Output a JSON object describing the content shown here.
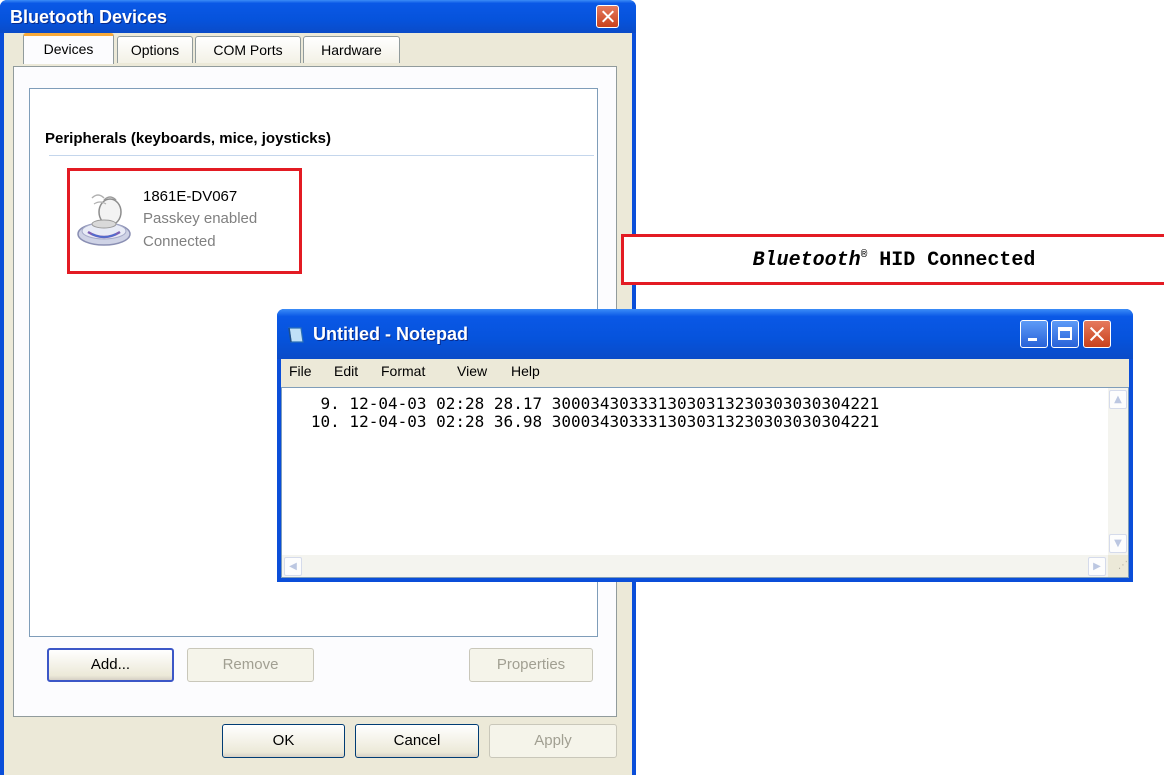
{
  "bt_window": {
    "title": "Bluetooth Devices",
    "tabs": [
      "Devices",
      "Options",
      "COM Ports",
      "Hardware"
    ],
    "active_tab": "Devices",
    "group_header": "Peripherals (keyboards, mice, joysticks)",
    "device": {
      "name": "1861E-DV067",
      "status_lines": [
        "Passkey enabled",
        "Connected"
      ],
      "icon": "bluetooth-mouse-icon"
    },
    "buttons": {
      "add": "Add...",
      "remove": "Remove",
      "properties": "Properties",
      "ok": "OK",
      "cancel": "Cancel",
      "apply": "Apply"
    }
  },
  "callout": {
    "brand": "Bluetooth",
    "mark": "®",
    "text": " HID Connected"
  },
  "notepad": {
    "title": "Untitled - Notepad",
    "menu": [
      "File",
      "Edit",
      "Format",
      "View",
      "Help"
    ],
    "lines": [
      "    9. 12-04-03 02:28 28.17 3000343033313030313230303030304221",
      "   10. 12-04-03 02:28 36.98 3000343033313030313230303030304221"
    ]
  },
  "colors": {
    "xp_title_blue": "#0653dc",
    "dialog_face": "#ece9d8",
    "highlight_red": "#e31b23",
    "tab_accent": "#f7a93a"
  }
}
